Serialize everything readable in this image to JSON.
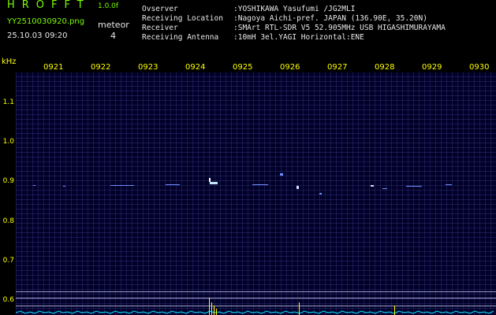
{
  "header": {
    "app_title": "HROFFT",
    "app_version": "1.0.0f",
    "file_name": "YY2510030920.png",
    "timestamp": "25.10.03 09:20",
    "meteor_label": "meteor",
    "meteor_count": "4",
    "info": [
      {
        "key": "Ovserver",
        "value": ":YOSHIKAWA Yasufumi /JG2MLI"
      },
      {
        "key": "Receiving Location",
        "value": ":Nagoya Aichi-pref. JAPAN (136.90E, 35.20N)"
      },
      {
        "key": "Receiver",
        "value": ":SMArt RTL-SDR V5 52.905MHz USB HIGASHIMURAYAMA"
      },
      {
        "key": "Receiving Antenna",
        "value": ":10mH 3el.YAGI Horizontal:ENE"
      }
    ]
  },
  "axis": {
    "y_unit": "kHz",
    "y_ticks": [
      "1.1",
      "1.0",
      "0.9",
      "0.8",
      "0.7",
      "0.6"
    ],
    "time_ticks": [
      "0921",
      "0922",
      "0923",
      "0924",
      "0925",
      "0926",
      "0927",
      "0928",
      "0929",
      "0930"
    ]
  },
  "colors": {
    "text_green": "#7CFC00",
    "text_yellow": "#FFFF00",
    "background": "#000000",
    "spectrogram_bg": "#000028"
  }
}
